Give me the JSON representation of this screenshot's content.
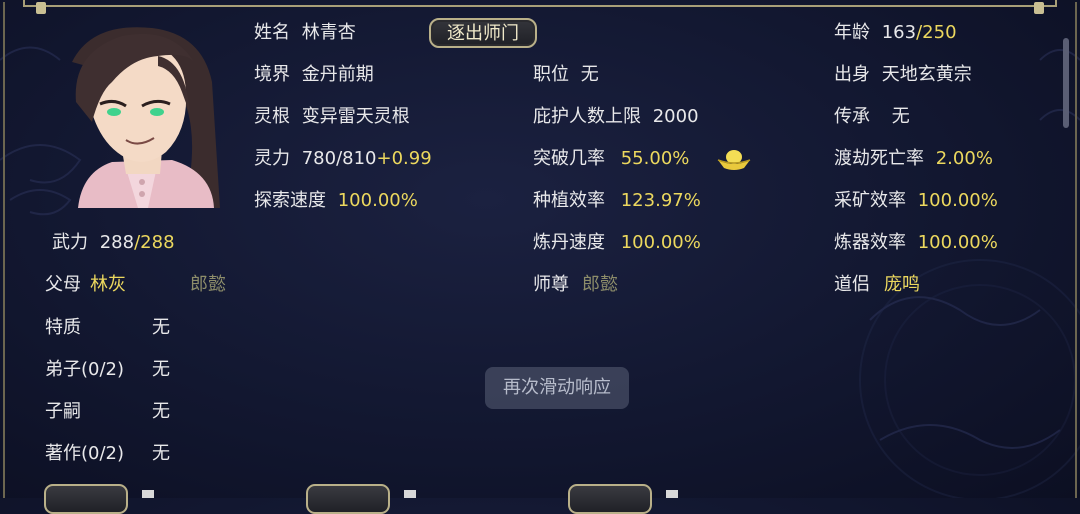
{
  "profile": {
    "name_label": "姓名",
    "name_value": "林青杏",
    "expel_button": "逐出师门",
    "age_label": "年龄",
    "age_current": "163",
    "age_max": "/250",
    "realm_label": "境界",
    "realm_value": "金丹前期",
    "position_label": "职位",
    "position_value": "无",
    "origin_label": "出身",
    "origin_value": "天地玄黄宗",
    "root_label": "灵根",
    "root_value": "变异雷天灵根",
    "protect_label": "庇护人数上限",
    "protect_value": "2000",
    "inherit_label": "传承",
    "inherit_value": "无",
    "power_label": "灵力",
    "power_value": "780/810",
    "power_regen": "+0.99",
    "breakthrough_label": "突破几率",
    "breakthrough_value": "55.00%",
    "tribulation_label": "渡劫死亡率",
    "tribulation_value": "2.00%",
    "explore_label": "探索速度",
    "explore_value": "100.00%",
    "plant_label": "种植效率",
    "plant_value": "123.97%",
    "mining_label": "采矿效率",
    "mining_value": "100.00%",
    "alchemy_label": "炼丹速度",
    "alchemy_value": "100.00%",
    "forge_label": "炼器效率",
    "forge_value": "100.00%",
    "force_label": "武力",
    "force_current": "288",
    "force_max": "/288",
    "parents_label": "父母",
    "parent1": "林灰",
    "parent2": "郎懿",
    "master_label": "师尊",
    "master_value": "郎懿",
    "partner_label": "道侣",
    "partner_value": "庞鸣",
    "trait_label": "特质",
    "trait_value": "无",
    "disciple_label": "弟子(0/2)",
    "disciple_value": "无",
    "heir_label": "子嗣",
    "heir_value": "无",
    "works_label": "著作(0/2)",
    "works_value": "无"
  },
  "toast": "再次滑动响应",
  "colors": {
    "highlight": "#ecd85e",
    "text": "#e8e8ea",
    "dim": "#8d8d6a",
    "frame": "#b9b089"
  },
  "icons": {
    "breakthrough": "golden-ingot-icon"
  }
}
